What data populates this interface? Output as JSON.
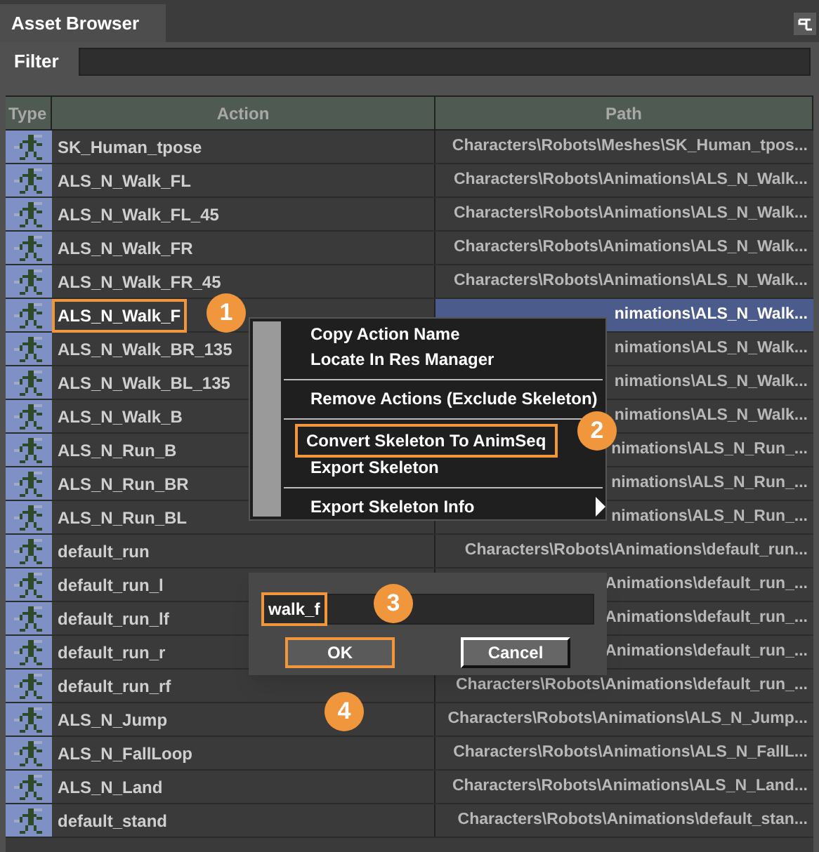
{
  "panel": {
    "title": "Asset Browser"
  },
  "filter": {
    "label": "Filter"
  },
  "table": {
    "columns": [
      "Type",
      "Action",
      "Path"
    ],
    "rows": [
      {
        "action": "SK_Human_tpose",
        "path": "Characters\\Robots\\Meshes\\SK_Human_tpos...",
        "selected": false,
        "highlighted": false
      },
      {
        "action": "ALS_N_Walk_FL",
        "path": "Characters\\Robots\\Animations\\ALS_N_Walk...",
        "selected": false,
        "highlighted": false
      },
      {
        "action": "ALS_N_Walk_FL_45",
        "path": "Characters\\Robots\\Animations\\ALS_N_Walk...",
        "selected": false,
        "highlighted": false
      },
      {
        "action": "ALS_N_Walk_FR",
        "path": "Characters\\Robots\\Animations\\ALS_N_Walk...",
        "selected": false,
        "highlighted": false
      },
      {
        "action": "ALS_N_Walk_FR_45",
        "path": "Characters\\Robots\\Animations\\ALS_N_Walk...",
        "selected": false,
        "highlighted": false
      },
      {
        "action": "ALS_N_Walk_F",
        "path": "nimations\\ALS_N_Walk...",
        "selected": true,
        "highlighted": true
      },
      {
        "action": "ALS_N_Walk_BR_135",
        "path": "nimations\\ALS_N_Walk...",
        "selected": false,
        "highlighted": false
      },
      {
        "action": "ALS_N_Walk_BL_135",
        "path": "nimations\\ALS_N_Walk...",
        "selected": false,
        "highlighted": false
      },
      {
        "action": "ALS_N_Walk_B",
        "path": "nimations\\ALS_N_Walk...",
        "selected": false,
        "highlighted": false
      },
      {
        "action": "ALS_N_Run_B",
        "path": "nimations\\ALS_N_Run_...",
        "selected": false,
        "highlighted": false
      },
      {
        "action": "ALS_N_Run_BR",
        "path": "nimations\\ALS_N_Run_...",
        "selected": false,
        "highlighted": false
      },
      {
        "action": "ALS_N_Run_BL",
        "path": "nimations\\ALS_N_Run_...",
        "selected": false,
        "highlighted": false
      },
      {
        "action": "default_run",
        "path": "Characters\\Robots\\Animations\\default_run...",
        "selected": false,
        "highlighted": false
      },
      {
        "action": "default_run_l",
        "path": "Animations\\default_run_...",
        "selected": false,
        "highlighted": false
      },
      {
        "action": "default_run_lf",
        "path": "Animations\\default_run_...",
        "selected": false,
        "highlighted": false
      },
      {
        "action": "default_run_r",
        "path": "Animations\\default_run_...",
        "selected": false,
        "highlighted": false
      },
      {
        "action": "default_run_rf",
        "path": "Characters\\Robots\\Animations\\default_run_...",
        "selected": false,
        "highlighted": false
      },
      {
        "action": "ALS_N_Jump",
        "path": "Characters\\Robots\\Animations\\ALS_N_Jump...",
        "selected": false,
        "highlighted": false
      },
      {
        "action": "ALS_N_FallLoop",
        "path": "Characters\\Robots\\Animations\\ALS_N_FallL...",
        "selected": false,
        "highlighted": false
      },
      {
        "action": "ALS_N_Land",
        "path": "Characters\\Robots\\Animations\\ALS_N_Land...",
        "selected": false,
        "highlighted": false
      },
      {
        "action": "default_stand",
        "path": "Characters\\Robots\\Animations\\default_stan...",
        "selected": false,
        "highlighted": false
      }
    ]
  },
  "context_menu": {
    "items": [
      {
        "kind": "item",
        "label": "Copy Action Name",
        "highlighted": false,
        "submenu": false
      },
      {
        "kind": "item",
        "label": "Locate In Res Manager",
        "highlighted": false,
        "submenu": false
      },
      {
        "kind": "separator"
      },
      {
        "kind": "item",
        "label": "Remove Actions (Exclude Skeleton)",
        "highlighted": false,
        "submenu": false
      },
      {
        "kind": "separator"
      },
      {
        "kind": "item",
        "label": "Convert Skeleton To AnimSeq",
        "highlighted": true,
        "submenu": false
      },
      {
        "kind": "item",
        "label": "Export Skeleton",
        "highlighted": false,
        "submenu": false
      },
      {
        "kind": "separator"
      },
      {
        "kind": "item",
        "label": "Export Skeleton Info",
        "highlighted": false,
        "submenu": true
      }
    ]
  },
  "dialog": {
    "value": "walk_f",
    "value_highlighted": true,
    "buttons": [
      {
        "label": "OK",
        "highlighted": true
      },
      {
        "label": "Cancel",
        "highlighted": false
      }
    ]
  },
  "callouts": [
    "1",
    "2",
    "3",
    "4"
  ]
}
